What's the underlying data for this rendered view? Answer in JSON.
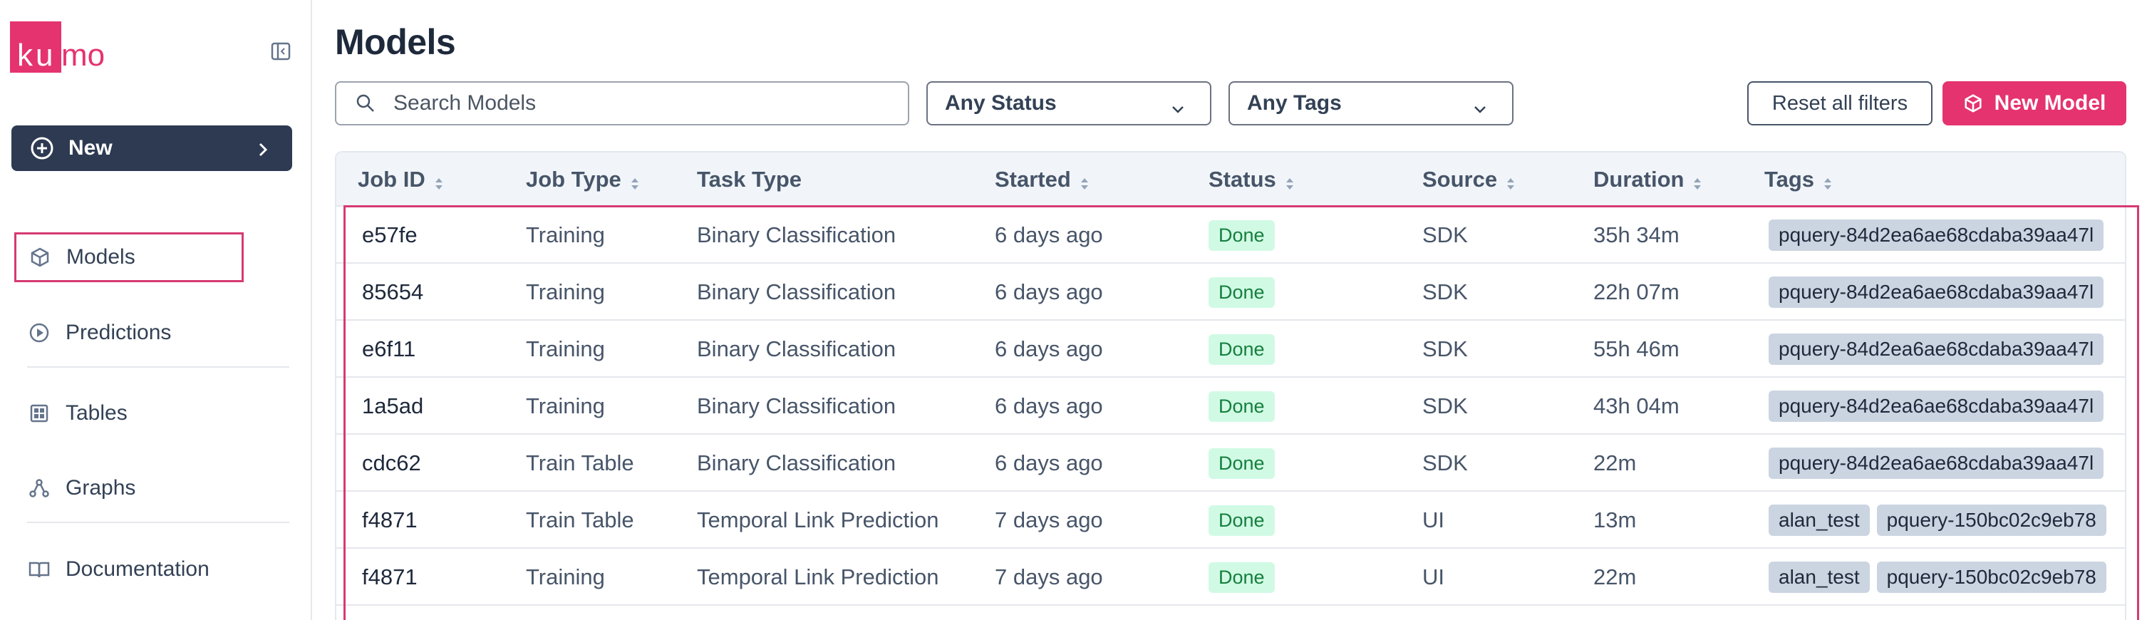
{
  "brand": {
    "name": "kumo",
    "accent": "#e5336f"
  },
  "sidebar": {
    "new_label": "New",
    "items": [
      {
        "label": "Models",
        "icon": "cube-icon",
        "active": true
      },
      {
        "label": "Predictions",
        "icon": "play-circle-icon",
        "active": false
      },
      {
        "label": "Tables",
        "icon": "table-icon",
        "active": false
      },
      {
        "label": "Graphs",
        "icon": "graph-icon",
        "active": false
      },
      {
        "label": "Documentation",
        "icon": "book-icon",
        "active": false
      }
    ]
  },
  "header": {
    "title": "Models",
    "search_placeholder": "Search Models",
    "status_filter": "Any Status",
    "tags_filter": "Any Tags",
    "reset_label": "Reset all filters",
    "new_model_label": "New Model"
  },
  "table": {
    "columns": [
      "Job ID",
      "Job Type",
      "Task Type",
      "Started",
      "Status",
      "Source",
      "Duration",
      "Tags"
    ],
    "rows": [
      {
        "id": "e57fe",
        "job_type": "Training",
        "task_type": "Binary Classification",
        "started": "6 days ago",
        "status": "Done",
        "source": "SDK",
        "duration": "35h 34m",
        "tags": [
          "pquery-84d2ea6ae68cdaba39aa47l"
        ]
      },
      {
        "id": "85654",
        "job_type": "Training",
        "task_type": "Binary Classification",
        "started": "6 days ago",
        "status": "Done",
        "source": "SDK",
        "duration": "22h 07m",
        "tags": [
          "pquery-84d2ea6ae68cdaba39aa47l"
        ]
      },
      {
        "id": "e6f11",
        "job_type": "Training",
        "task_type": "Binary Classification",
        "started": "6 days ago",
        "status": "Done",
        "source": "SDK",
        "duration": "55h 46m",
        "tags": [
          "pquery-84d2ea6ae68cdaba39aa47l"
        ]
      },
      {
        "id": "1a5ad",
        "job_type": "Training",
        "task_type": "Binary Classification",
        "started": "6 days ago",
        "status": "Done",
        "source": "SDK",
        "duration": "43h 04m",
        "tags": [
          "pquery-84d2ea6ae68cdaba39aa47l"
        ]
      },
      {
        "id": "cdc62",
        "job_type": "Train Table",
        "task_type": "Binary Classification",
        "started": "6 days ago",
        "status": "Done",
        "source": "SDK",
        "duration": "22m",
        "tags": [
          "pquery-84d2ea6ae68cdaba39aa47l"
        ]
      },
      {
        "id": "f4871",
        "job_type": "Train Table",
        "task_type": "Temporal Link Prediction",
        "started": "7 days ago",
        "status": "Done",
        "source": "UI",
        "duration": "13m",
        "tags": [
          "alan_test",
          "pquery-150bc02c9eb78"
        ]
      },
      {
        "id": "f4871",
        "job_type": "Training",
        "task_type": "Temporal Link Prediction",
        "started": "7 days ago",
        "status": "Done",
        "source": "UI",
        "duration": "22m",
        "tags": [
          "alan_test",
          "pquery-150bc02c9eb78"
        ]
      }
    ]
  }
}
